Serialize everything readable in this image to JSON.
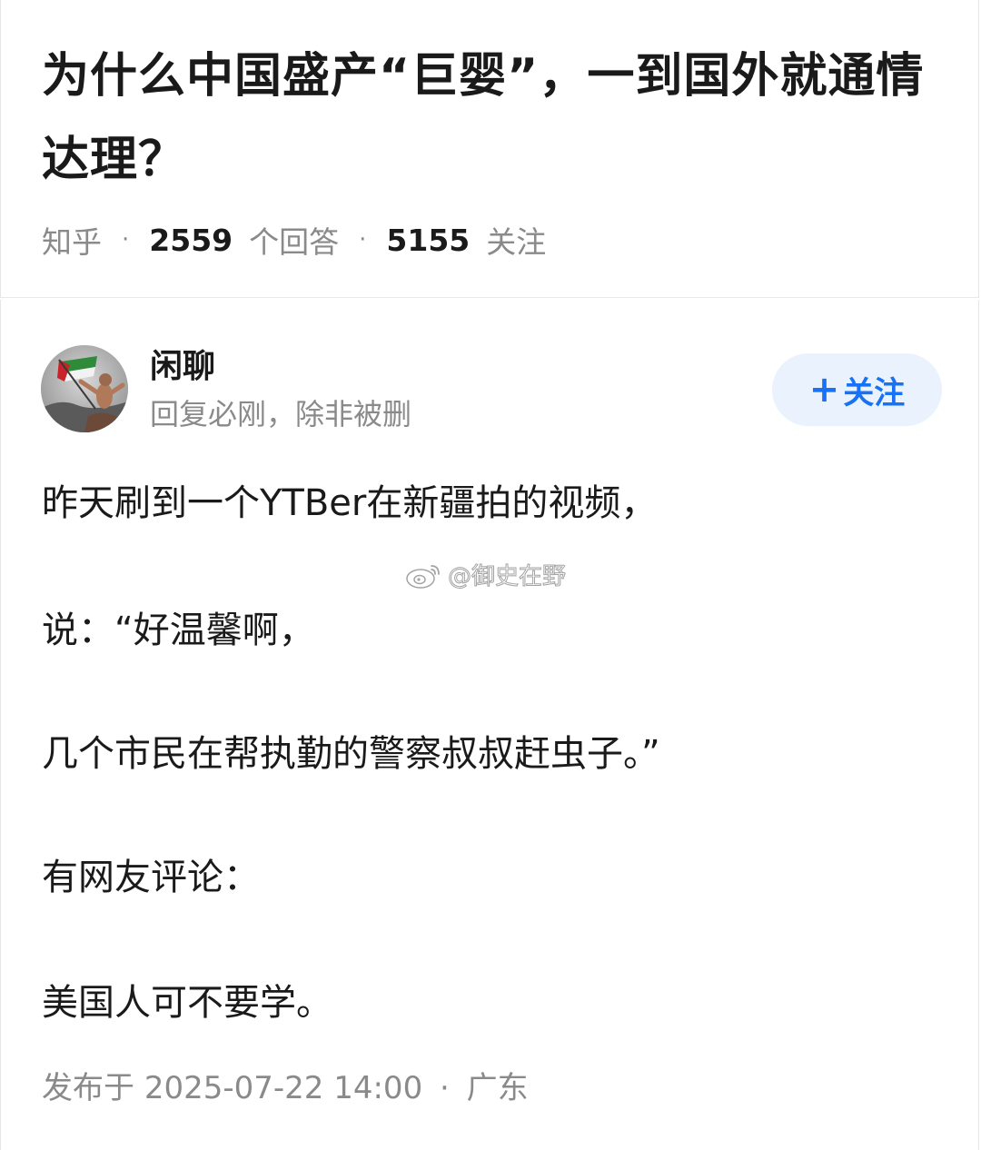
{
  "question": {
    "title": "为什么中国盛产“巨婴”，一到国外就通情达理？",
    "source": "知乎",
    "answers_count": "2559",
    "answers_label": "个回答",
    "followers_count": "5155",
    "followers_label": "关注"
  },
  "answer": {
    "author_name": "闲聊",
    "author_bio": "回复必刚，除非被删",
    "follow_button_label": "关注",
    "follow_button_icon": "plus-icon",
    "paragraphs": [
      "昨天刷到一个YTBer在新疆拍的视频，",
      "说：“好温馨啊，",
      "几个市民在帮执勤的警察叔叔赶虫子。”",
      "有网友评论：",
      "美国人可不要学。"
    ],
    "published_label": "发布于",
    "published_time": "2025-07-22 14:00",
    "location": "广东"
  },
  "watermark": {
    "text": "@御史在野",
    "icon": "weibo-icon"
  },
  "colors": {
    "accent": "#1772f6",
    "follow_bg": "#eaf2fd",
    "muted_text": "#8a8a8a",
    "main_text": "#1a1a1a"
  }
}
